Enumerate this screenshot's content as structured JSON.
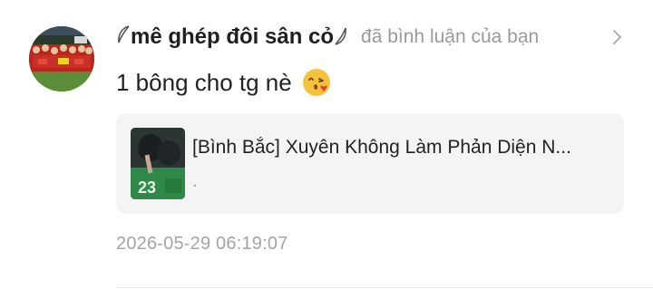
{
  "notification": {
    "user": {
      "name": "mê ghép đôi sân cỏ",
      "avatar_icon": "team-photo-avatar"
    },
    "action_text": "đã bình luận của bạn",
    "comment": {
      "text": "1 bông cho tg nè",
      "emoji_icon": "face-blowing-kiss-icon"
    },
    "linked_story": {
      "title": "[Bình Bắc] Xuyên Không Làm Phản Diện N...",
      "subtitle": ".",
      "thumbnail_icon": "story-cover-thumbnail"
    },
    "timestamp": "2026-05-29 06:19:07"
  },
  "colors": {
    "muted_text": "#9a9a9a",
    "card_background": "#f4f4f4",
    "primary_text": "#222222"
  }
}
